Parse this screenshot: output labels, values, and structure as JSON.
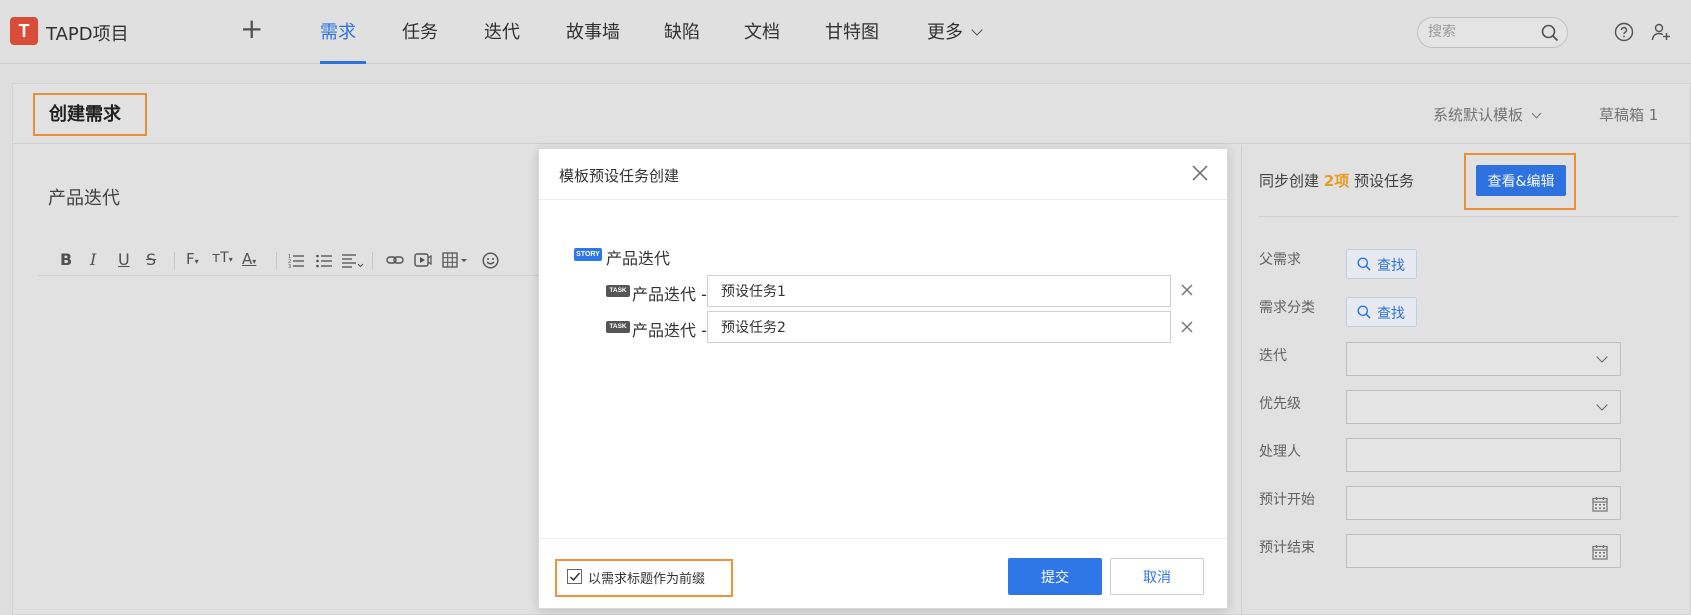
{
  "app": {
    "logo_letter": "T",
    "title": "TAPD项目"
  },
  "nav": {
    "tabs": [
      {
        "label": "需求"
      },
      {
        "label": "任务"
      },
      {
        "label": "迭代"
      },
      {
        "label": "故事墙"
      },
      {
        "label": "缺陷"
      },
      {
        "label": "文档"
      },
      {
        "label": "甘特图"
      },
      {
        "label": "更多"
      }
    ],
    "active_tab": "需求",
    "search_placeholder": "搜索"
  },
  "page": {
    "title": "创建需求",
    "template_select": "系统默认模板",
    "drafts": "草稿箱 1",
    "doc_title": "产品迭代"
  },
  "right_panel": {
    "sync_prefix": "同步创建",
    "sync_count": "2项",
    "sync_suffix": "预设任务",
    "view_edit_button": "查看&编辑",
    "fields": [
      {
        "label": "父需求",
        "type": "find",
        "button": "查找"
      },
      {
        "label": "需求分类",
        "type": "find",
        "button": "查找"
      },
      {
        "label": "迭代",
        "type": "select",
        "value": ""
      },
      {
        "label": "优先级",
        "type": "select",
        "value": ""
      },
      {
        "label": "处理人",
        "type": "input",
        "value": ""
      },
      {
        "label": "预计开始",
        "type": "date",
        "value": ""
      },
      {
        "label": "预计结束",
        "type": "date",
        "value": ""
      }
    ]
  },
  "modal": {
    "title": "模板预设任务创建",
    "story_badge": "STORY",
    "story_name": "产品迭代",
    "task_badge": "TASK",
    "task_prefix": "产品迭代 -",
    "tasks": [
      {
        "value": "预设任务1"
      },
      {
        "value": "预设任务2"
      }
    ],
    "prefix_checkbox_label": "以需求标题作为前缀",
    "prefix_checked": true,
    "submit_label": "提交",
    "cancel_label": "取消"
  },
  "colors": {
    "primary": "#2f76e6",
    "highlight_frame": "#f0943a",
    "count": "#f0a020",
    "logo": "#e04f3a"
  },
  "toolbar_icons": [
    "bold-icon",
    "italic-icon",
    "underline-icon",
    "strikethrough-icon",
    "font-family-icon",
    "font-size-icon",
    "font-color-icon",
    "ordered-list-icon",
    "unordered-list-icon",
    "align-icon",
    "link-icon",
    "video-icon",
    "table-icon",
    "emoji-icon"
  ]
}
